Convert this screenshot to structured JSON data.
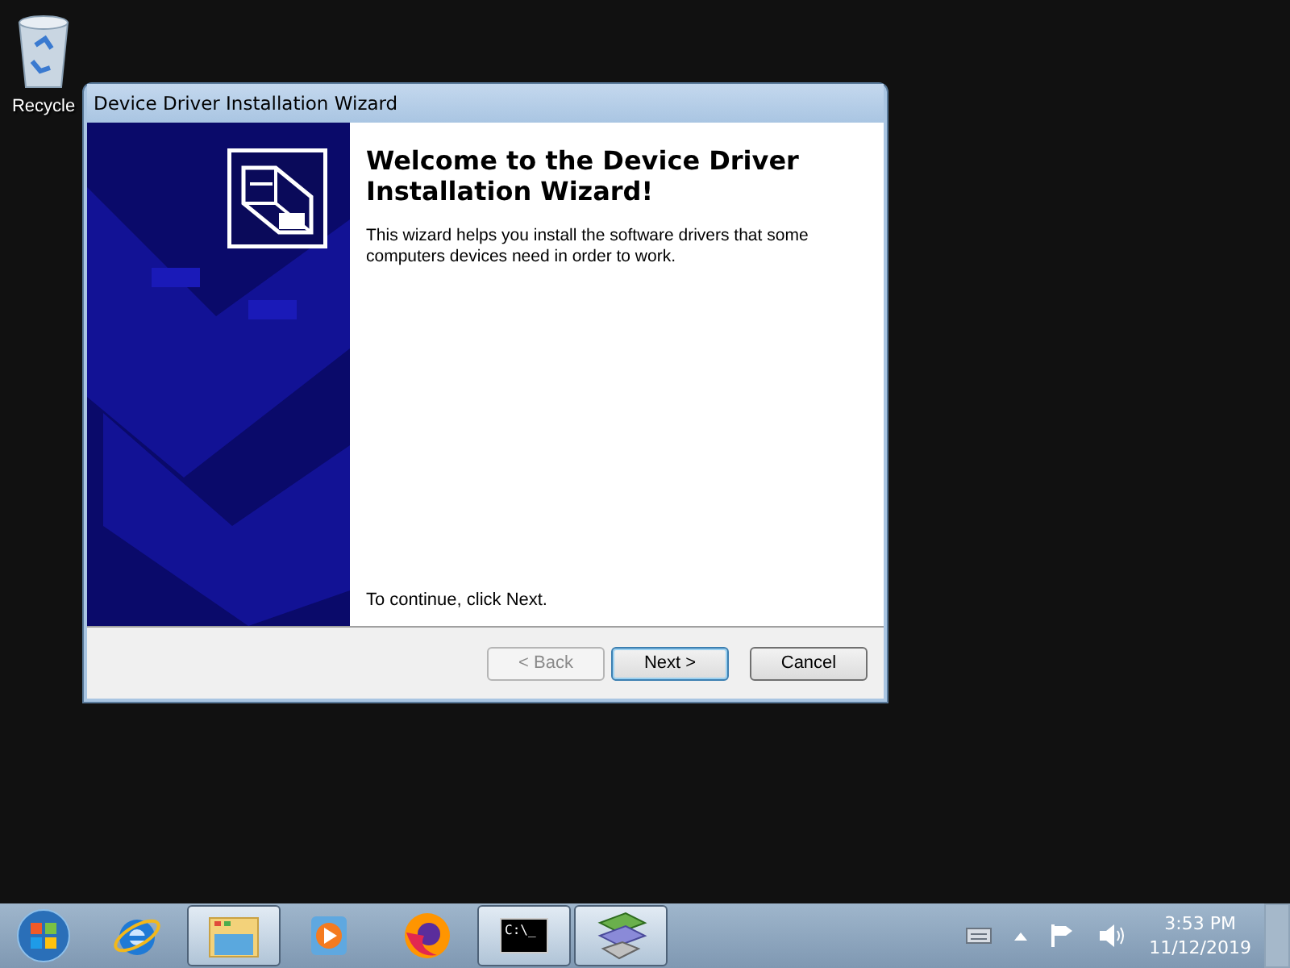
{
  "desktop": {
    "icons": [
      {
        "label": "Recycle"
      }
    ]
  },
  "window": {
    "title": "Device Driver Installation Wizard",
    "heading": "Welcome to the Device Driver Installation Wizard!",
    "description": "This wizard helps you install the software drivers that some computers devices need in order to work.",
    "footer_text": "To continue, click Next.",
    "buttons": [
      {
        "label": "< Back",
        "disabled": true,
        "default": false
      },
      {
        "label": "Next >",
        "disabled": false,
        "default": true
      },
      {
        "label": "Cancel",
        "disabled": false,
        "default": false
      }
    ]
  },
  "taskbar": {
    "items": [
      {
        "kind": "start"
      },
      {
        "kind": "ie",
        "running": false
      },
      {
        "kind": "explorer",
        "running": true
      },
      {
        "kind": "media",
        "running": false
      },
      {
        "kind": "firefox",
        "running": false
      },
      {
        "kind": "cmd",
        "running": true,
        "text": "C:\\_"
      },
      {
        "kind": "wizard",
        "running": true
      }
    ],
    "tray": {
      "time": "3:53 PM",
      "date": "11/12/2019"
    }
  }
}
